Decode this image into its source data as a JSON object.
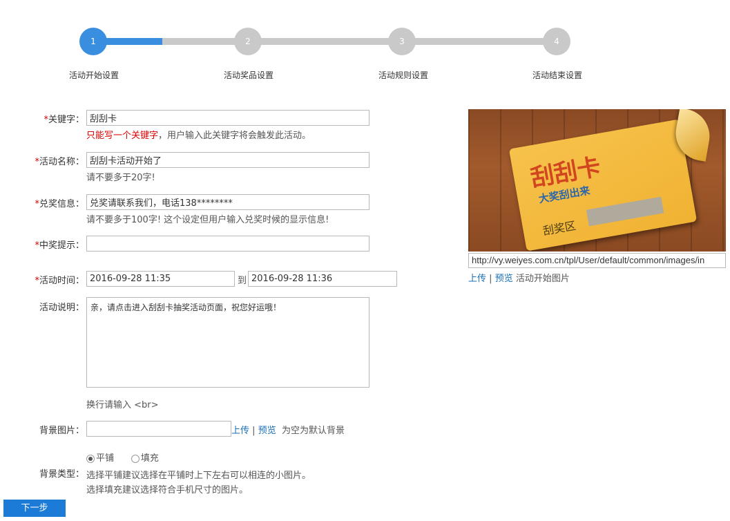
{
  "steps": [
    {
      "num": "1",
      "label": "活动开始设置"
    },
    {
      "num": "2",
      "label": "活动奖品设置"
    },
    {
      "num": "3",
      "label": "活动规则设置"
    },
    {
      "num": "4",
      "label": "活动结束设置"
    }
  ],
  "form": {
    "keyword": {
      "label_req": "*",
      "label": "关键字：",
      "value": "刮刮卡",
      "hint_red": "只能写一个关键字",
      "hint_rest": "，用户输入此关键字将会触发此活动。"
    },
    "name": {
      "label_req": "*",
      "label": "活动名称：",
      "value": "刮刮卡活动开始了",
      "hint": "请不要多于20字!"
    },
    "redeem": {
      "label_req": "*",
      "label": "兑奖信息：",
      "value": "兑奖请联系我们，电话138********",
      "hint": "请不要多于100字! 这个设定但用户输入兑奖时候的显示信息!"
    },
    "prize_tip": {
      "label_req": "*",
      "label": "中奖提示：",
      "value": ""
    },
    "time": {
      "label_req": "*",
      "label": "活动时间：",
      "start": "2016-09-28 11:35",
      "to": "到",
      "end": "2016-09-28 11:36"
    },
    "desc": {
      "label": "活动说明：",
      "value": "亲，请点击进入刮刮卡抽奖活动页面，祝您好运哦！",
      "hint": "换行请输入 <br>"
    },
    "bg_image": {
      "label": "背景图片：",
      "value": "",
      "upload": "上传",
      "sep": "|",
      "preview": "预览",
      "note": "为空为默认背景"
    },
    "bg_type": {
      "label": "背景类型：",
      "options": [
        "平铺",
        "填充"
      ],
      "selected": "平铺",
      "desc1": "选择平铺建议选择在平铺时上下左右可以相连的小图片。",
      "desc2": "选择填充建议选择符合手机尺寸的图片。"
    }
  },
  "next_button": "下一步",
  "preview": {
    "card_title": "刮刮卡",
    "card_subtitle": "大奖刮出来",
    "card_area": "刮奖区",
    "url": "http://vy.weiyes.com.cn/tpl/User/default/common/images/in",
    "upload": "上传",
    "sep": "|",
    "preview_link": "预览",
    "caption": "活动开始图片"
  },
  "colors": {
    "accent": "#3a8ee0",
    "button": "#1d7bd8",
    "required": "#dd0000",
    "link": "#1a6fb5"
  }
}
